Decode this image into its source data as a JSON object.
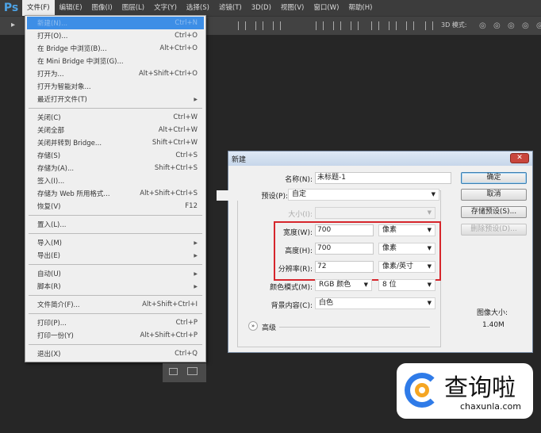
{
  "app": {
    "logo": "Ps"
  },
  "menubar": [
    "文件(F)",
    "编辑(E)",
    "图像(I)",
    "图层(L)",
    "文字(Y)",
    "选择(S)",
    "滤镜(T)",
    "3D(D)",
    "视图(V)",
    "窗口(W)",
    "帮助(H)"
  ],
  "toolbar": {
    "mode_3d_label": "3D 模式:"
  },
  "file_menu": {
    "groups": [
      [
        {
          "label": "新建(N)...",
          "shortcut": "Ctrl+N",
          "highlighted": true
        },
        {
          "label": "打开(O)...",
          "shortcut": "Ctrl+O"
        },
        {
          "label": "在 Bridge 中浏览(B)...",
          "shortcut": "Alt+Ctrl+O"
        },
        {
          "label": "在 Mini Bridge 中浏览(G)...",
          "shortcut": ""
        },
        {
          "label": "打开为...",
          "shortcut": "Alt+Shift+Ctrl+O"
        },
        {
          "label": "打开为智能对象...",
          "shortcut": ""
        },
        {
          "label": "最近打开文件(T)",
          "shortcut": "",
          "submenu": true
        }
      ],
      [
        {
          "label": "关闭(C)",
          "shortcut": "Ctrl+W"
        },
        {
          "label": "关闭全部",
          "shortcut": "Alt+Ctrl+W"
        },
        {
          "label": "关闭并转到 Bridge...",
          "shortcut": "Shift+Ctrl+W"
        },
        {
          "label": "存储(S)",
          "shortcut": "Ctrl+S"
        },
        {
          "label": "存储为(A)...",
          "shortcut": "Shift+Ctrl+S"
        },
        {
          "label": "签入(I)...",
          "shortcut": ""
        },
        {
          "label": "存储为 Web 所用格式...",
          "shortcut": "Alt+Shift+Ctrl+S"
        },
        {
          "label": "恢复(V)",
          "shortcut": "F12"
        }
      ],
      [
        {
          "label": "置入(L)...",
          "shortcut": ""
        }
      ],
      [
        {
          "label": "导入(M)",
          "shortcut": "",
          "submenu": true
        },
        {
          "label": "导出(E)",
          "shortcut": "",
          "submenu": true
        }
      ],
      [
        {
          "label": "自动(U)",
          "shortcut": "",
          "submenu": true
        },
        {
          "label": "脚本(R)",
          "shortcut": "",
          "submenu": true
        }
      ],
      [
        {
          "label": "文件简介(F)...",
          "shortcut": "Alt+Shift+Ctrl+I"
        }
      ],
      [
        {
          "label": "打印(P)...",
          "shortcut": "Ctrl+P"
        },
        {
          "label": "打印一份(Y)",
          "shortcut": "Alt+Shift+Ctrl+P"
        }
      ],
      [
        {
          "label": "退出(X)",
          "shortcut": "Ctrl+Q"
        }
      ]
    ]
  },
  "dialog": {
    "title": "新建",
    "close": "✕",
    "name_label": "名称(N):",
    "name_value": "未标题-1",
    "preset_label": "预设(P):",
    "preset_value": "自定",
    "size_label": "大小(I):",
    "size_value": "",
    "width_label": "宽度(W):",
    "width_value": "700",
    "width_unit": "像素",
    "height_label": "高度(H):",
    "height_value": "700",
    "height_unit": "像素",
    "resolution_label": "分辨率(R):",
    "resolution_value": "72",
    "resolution_unit": "像素/英寸",
    "color_mode_label": "颜色模式(M):",
    "color_mode_value": "RGB 颜色",
    "bit_depth_value": "8 位",
    "background_label": "背景内容(C):",
    "background_value": "白色",
    "advanced_label": "高级",
    "ok": "确定",
    "cancel": "取消",
    "save_preset": "存储预设(S)...",
    "delete_preset": "删除预设(D)...",
    "image_size_label": "图像大小:",
    "image_size_value": "1.40M",
    "highlight_color": "#d6262c"
  },
  "watermark": {
    "brand": "查询啦",
    "url": "chaxunla.com"
  }
}
